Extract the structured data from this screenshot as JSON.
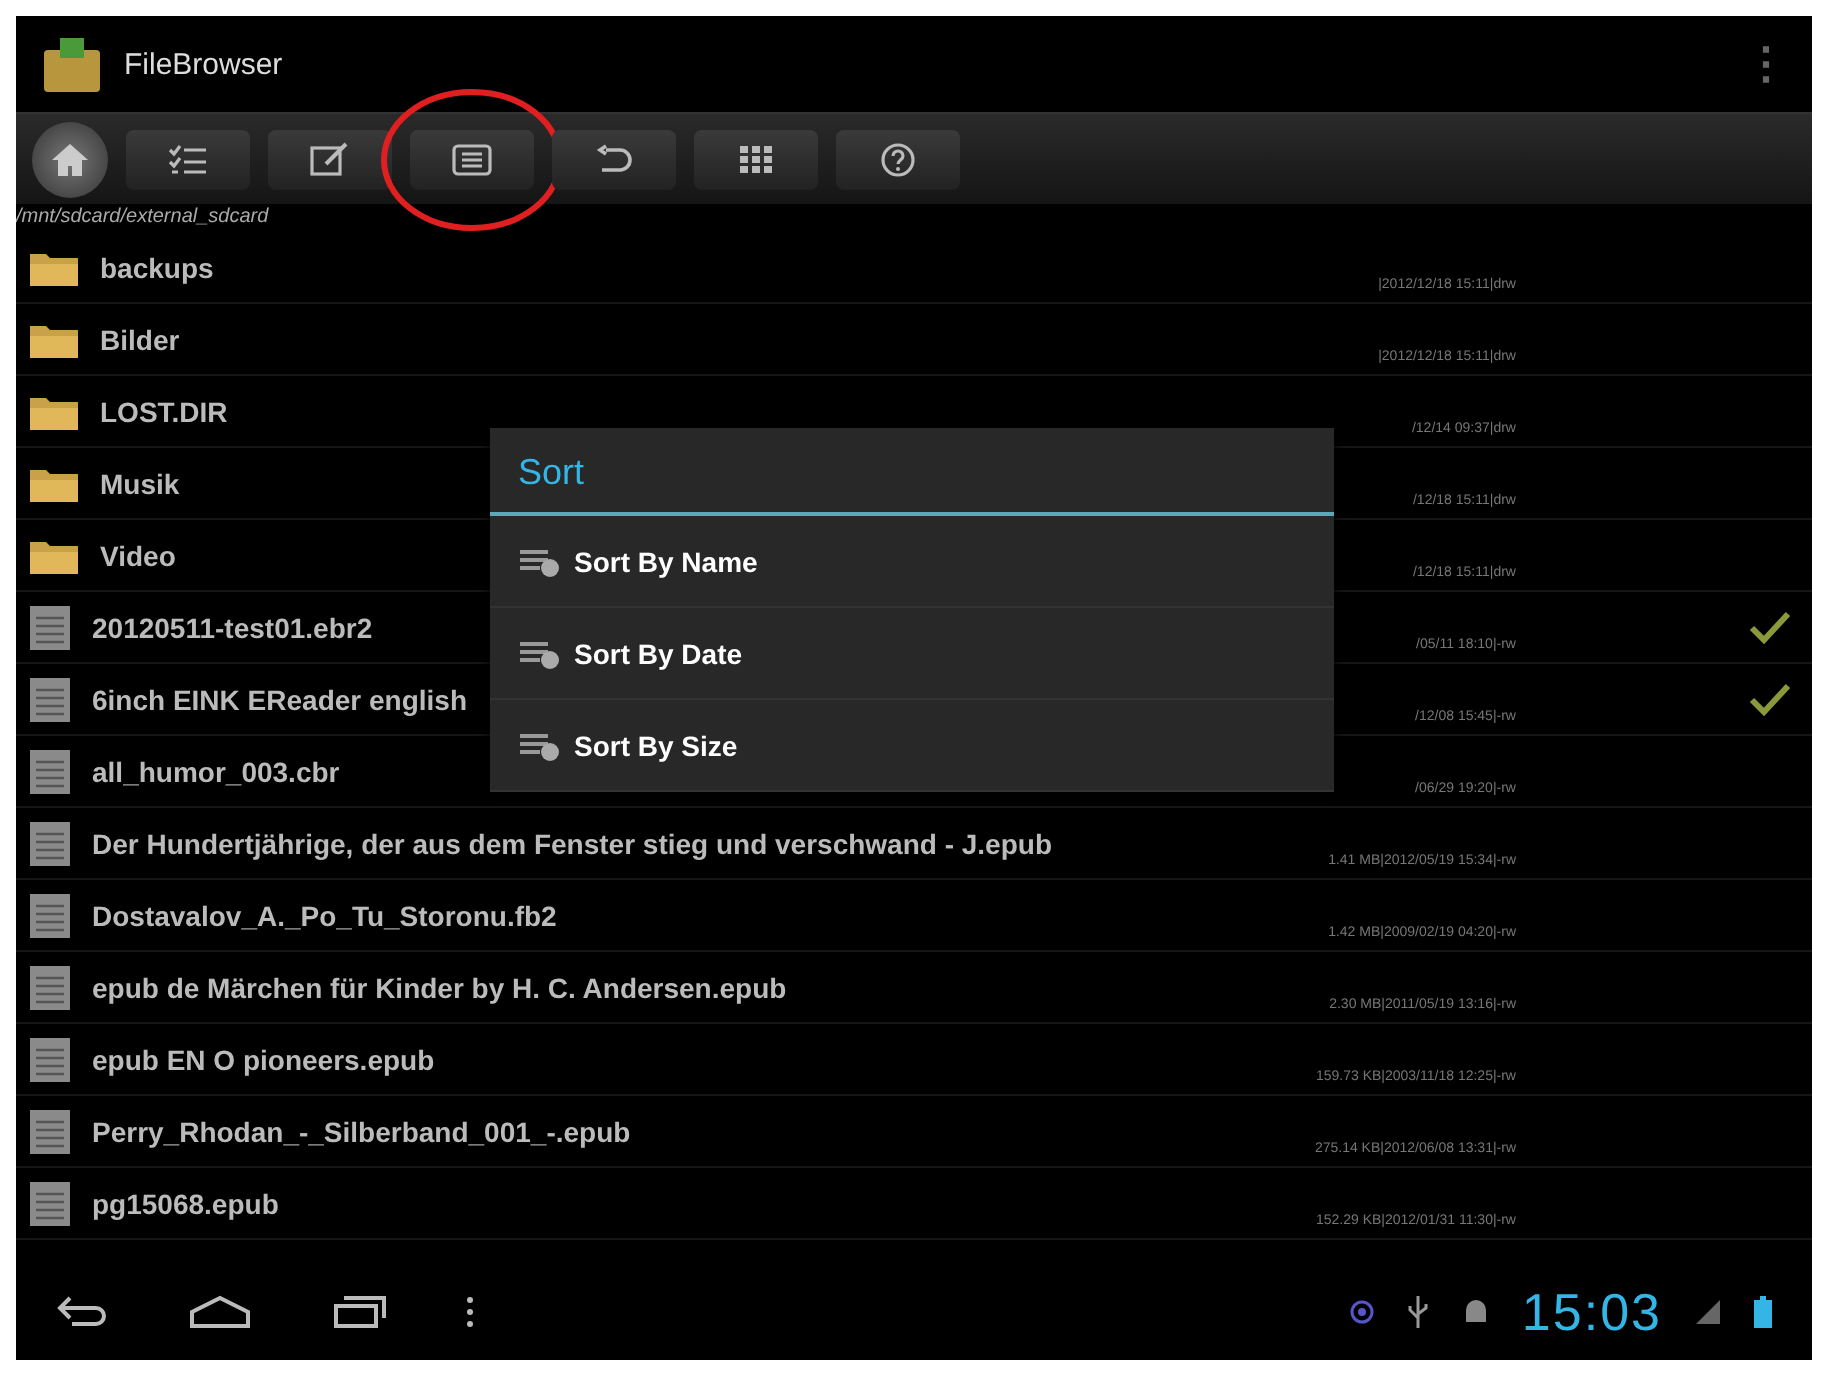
{
  "app_bar": {
    "title": "FileBrowser",
    "menu": "⋮"
  },
  "toolbar": [
    {
      "kind": "home",
      "circled": false
    },
    {
      "kind": "checklist",
      "circled": false
    },
    {
      "kind": "edit",
      "circled": false
    },
    {
      "kind": "list",
      "circled": true
    },
    {
      "kind": "undo",
      "circled": false
    },
    {
      "kind": "grid",
      "circled": false
    },
    {
      "kind": "help",
      "circled": false
    }
  ],
  "path": "/mnt/sdcard/external_sdcard",
  "files": [
    {
      "kind": "folder",
      "name": "backups",
      "meta": "|2012/12/18 15:11|drw",
      "checked": false
    },
    {
      "kind": "folder",
      "name": "Bilder",
      "meta": "|2012/12/18 15:11|drw",
      "checked": false
    },
    {
      "kind": "folder",
      "name": "LOST.DIR",
      "meta": "/12/14 09:37|drw",
      "checked": false
    },
    {
      "kind": "folder",
      "name": "Musik",
      "meta": "/12/18 15:11|drw",
      "checked": false
    },
    {
      "kind": "folder",
      "name": "Video",
      "meta": "/12/18 15:11|drw",
      "checked": false
    },
    {
      "kind": "file",
      "name": "20120511-test01.ebr2",
      "meta": "/05/11 18:10|-rw",
      "checked": true
    },
    {
      "kind": "file",
      "name": "6inch EINK EReader english",
      "meta": "/12/08 15:45|-rw",
      "checked": true
    },
    {
      "kind": "file",
      "name": "all_humor_003.cbr",
      "meta": "/06/29 19:20|-rw",
      "checked": false
    },
    {
      "kind": "file",
      "name": "Der Hundertjährige, der aus dem Fenster stieg und verschwand - J.epub",
      "meta": "1.41 MB|2012/05/19 15:34|-rw",
      "checked": false
    },
    {
      "kind": "file",
      "name": "Dostavalov_A._Po_Tu_Storonu.fb2",
      "meta": "1.42 MB|2009/02/19 04:20|-rw",
      "checked": false
    },
    {
      "kind": "file",
      "name": "epub de Märchen für Kinder by H. C. Andersen.epub",
      "meta": "2.30 MB|2011/05/19 13:16|-rw",
      "checked": false
    },
    {
      "kind": "file",
      "name": "epub EN O pioneers.epub",
      "meta": "159.73 KB|2003/11/18 12:25|-rw",
      "checked": false
    },
    {
      "kind": "file",
      "name": "Perry_Rhodan_-_Silberband_001_-.epub",
      "meta": "275.14 KB|2012/06/08 13:31|-rw",
      "checked": false
    },
    {
      "kind": "file",
      "name": "pg15068.epub",
      "meta": "152.29 KB|2012/01/31 11:30|-rw",
      "checked": false
    }
  ],
  "sort_dialog": {
    "title": "Sort",
    "options": [
      "Sort By Name",
      "Sort By Date",
      "Sort By Size"
    ]
  },
  "nav_bar": {
    "buttons": [
      {
        "kind": "back"
      },
      {
        "kind": "home"
      },
      {
        "kind": "recents"
      },
      {
        "kind": "menu"
      }
    ],
    "time": "15:03"
  }
}
